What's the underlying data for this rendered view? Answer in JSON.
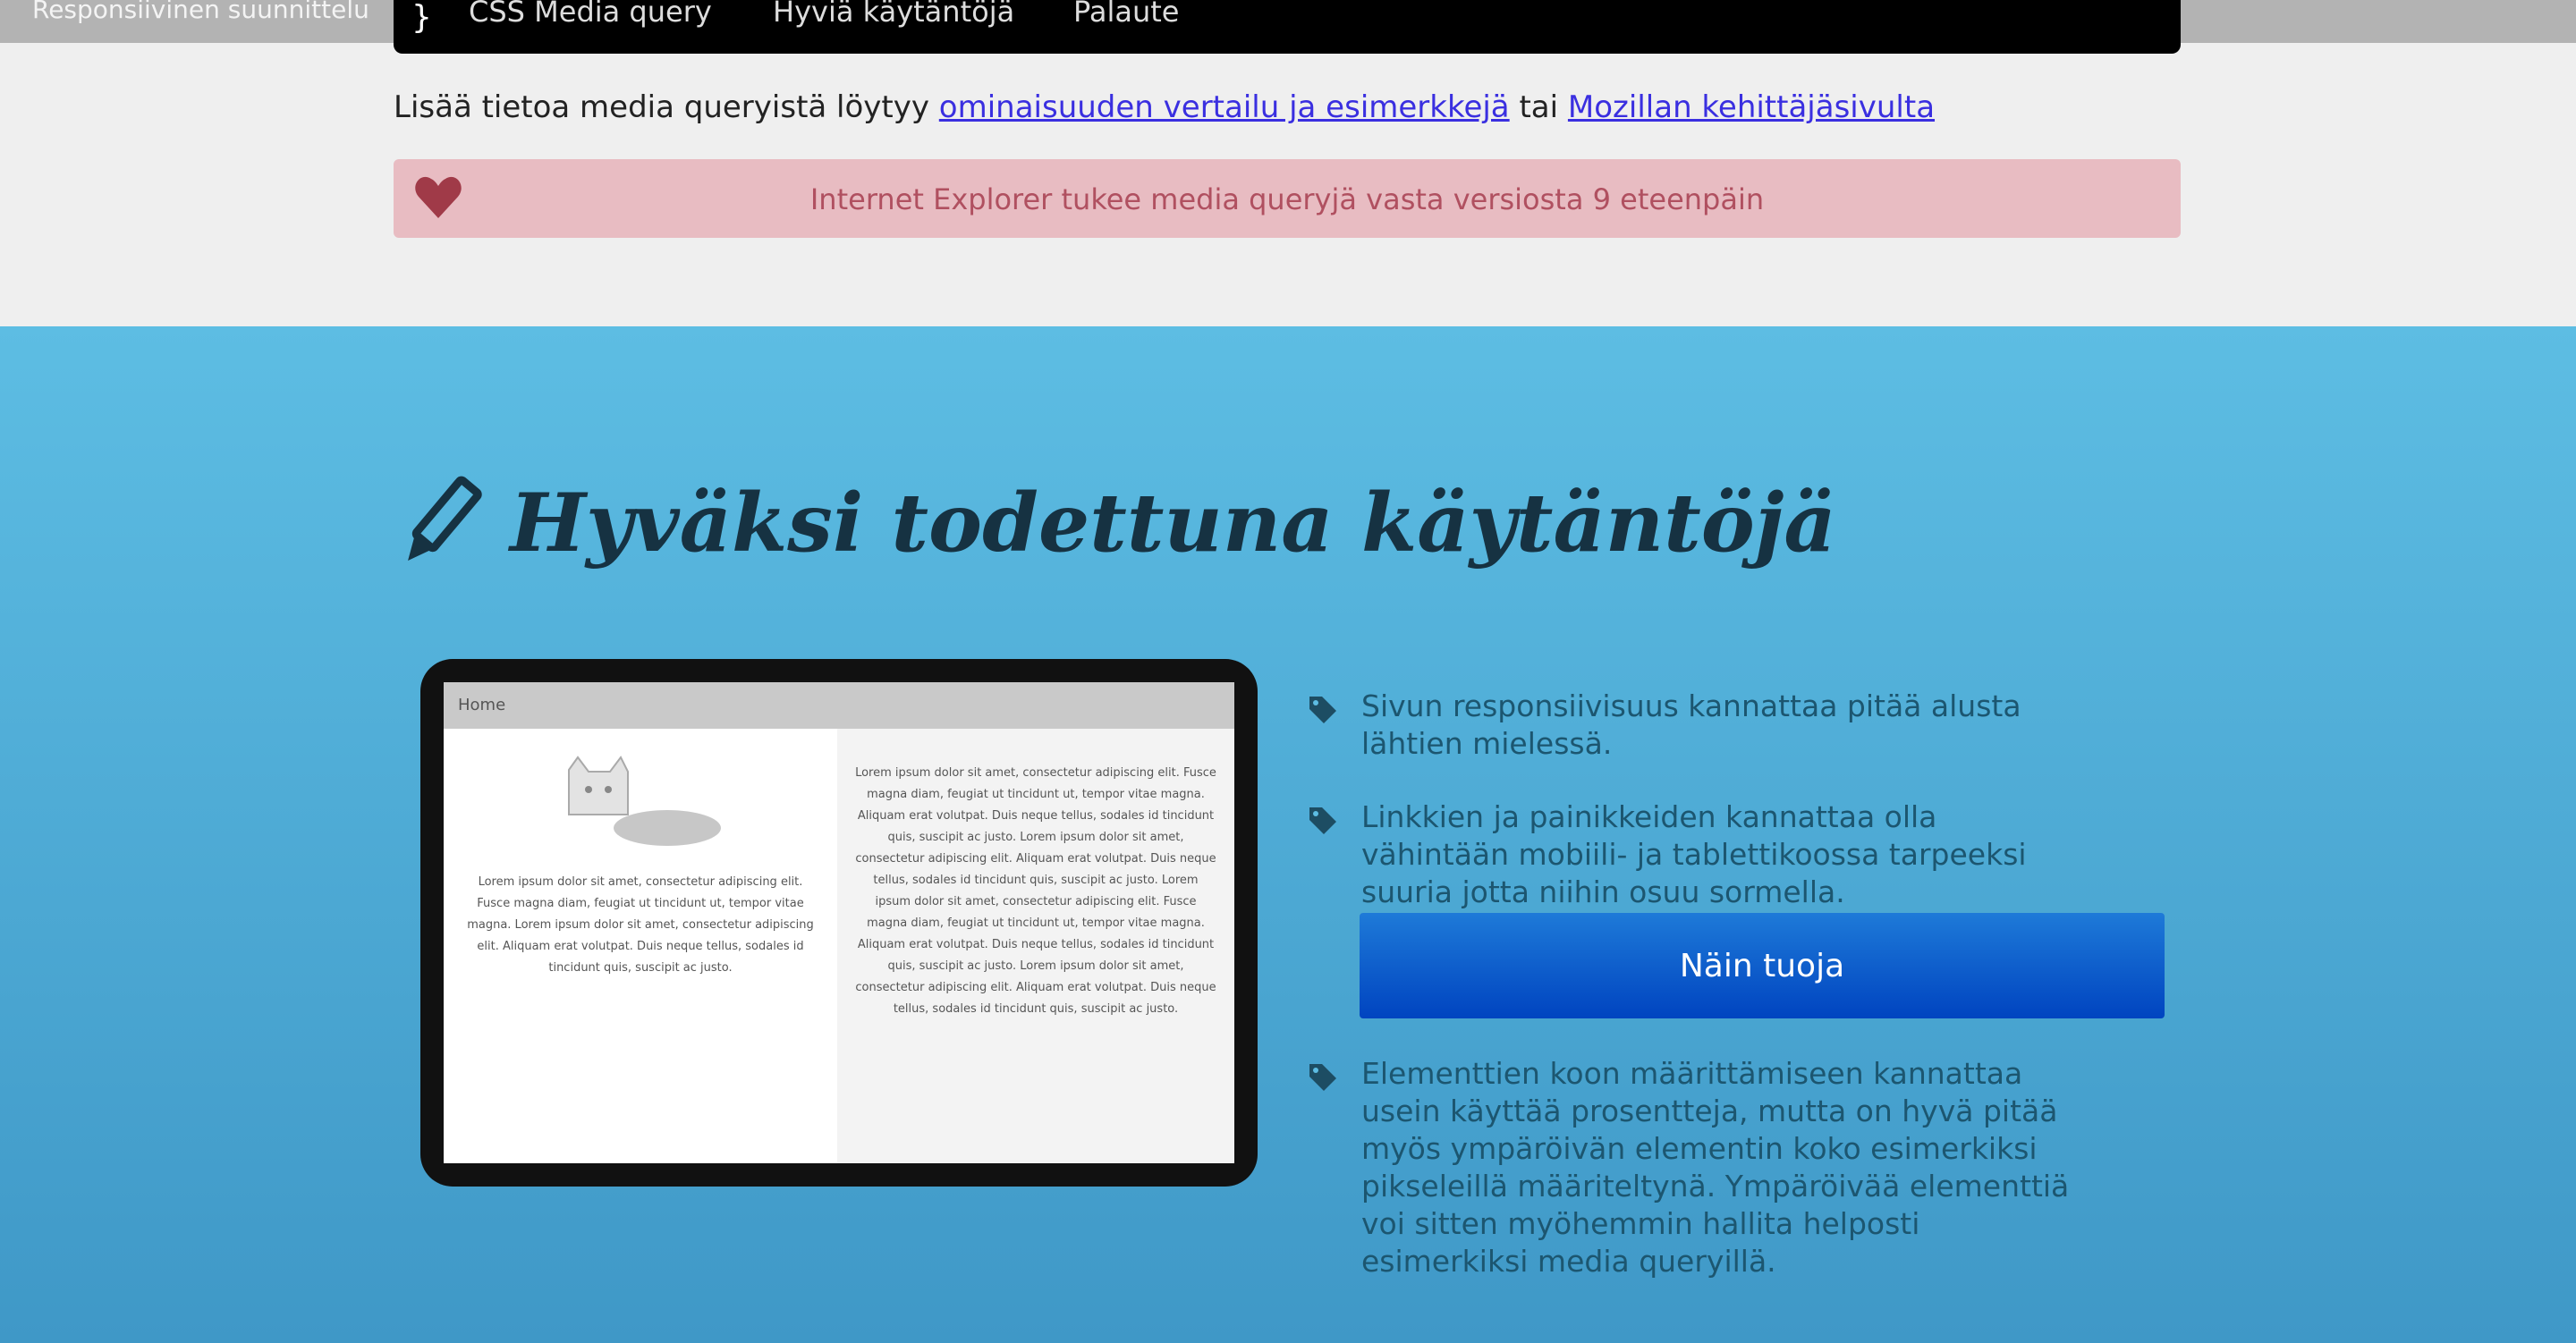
{
  "header": {
    "site_title": "Responsiivinen suunnittelu",
    "nav_brace": "}",
    "nav_items": [
      "CSS Media query",
      "Hyviä käytäntöjä",
      "Palaute"
    ]
  },
  "more_info": {
    "prefix": "Lisää tietoa media queryistä löytyy",
    "link1": "ominaisuuden vertailu ja esimerkkejä",
    "middle": "tai",
    "link2": "Mozillan kehittäjäsivulta"
  },
  "ie_notice": {
    "text": "Internet Explorer tukee media queryjä vasta versiosta 9 eteenpäin",
    "icon": "heart-icon",
    "color": "#b05060"
  },
  "section": {
    "title": "Hyväksi todettuna käytäntöjä",
    "title_icon": "pencil-icon",
    "background": "#5dbde3"
  },
  "tablet": {
    "bar_label": "Home",
    "left_text": "Lorem ipsum dolor sit amet, consectetur adipiscing elit. Fusce magna diam, feugiat ut tincidunt ut, tempor vitae magna. Lorem ipsum dolor sit amet, consectetur adipiscing elit. Aliquam erat volutpat. Duis neque tellus, sodales id tincidunt quis, suscipit ac justo.",
    "right_text": "Lorem ipsum dolor sit amet, consectetur adipiscing elit. Fusce magna diam, feugiat ut tincidunt ut, tempor vitae magna. Aliquam erat volutpat. Duis neque tellus, sodales id tincidunt quis, suscipit ac justo. Lorem ipsum dolor sit amet, consectetur adipiscing elit. Aliquam erat volutpat. Duis neque tellus, sodales id tincidunt quis, suscipit ac justo. Lorem ipsum dolor sit amet, consectetur adipiscing elit. Fusce magna diam, feugiat ut tincidunt ut, tempor vitae magna. Aliquam erat volutpat. Duis neque tellus, sodales id tincidunt quis, suscipit ac justo. Lorem ipsum dolor sit amet, consectetur adipiscing elit. Aliquam erat volutpat. Duis neque tellus, sodales id tincidunt quis, suscipit ac justo."
  },
  "tips": [
    "Sivun responsiivisuus kannattaa pitää alusta lähtien mielessä.",
    "Linkkien ja painikkeiden kannattaa olla vähintään mobiili- ja tablettikoossa tarpeeksi suuria jotta niihin osuu sormella.",
    "Elementtien koon määrittämiseen kannattaa usein käyttää prosentteja, mutta on hyvä pitää myös ympäröivän elementin koko esimerkiksi pikseleillä määriteltynä. Ympäröivää elementtiä voi sitten myöhemmin hallita helposti esimerkiksi media queryillä."
  ],
  "cta_label": "Näin tuoja",
  "tip_icon": "tag-icon"
}
